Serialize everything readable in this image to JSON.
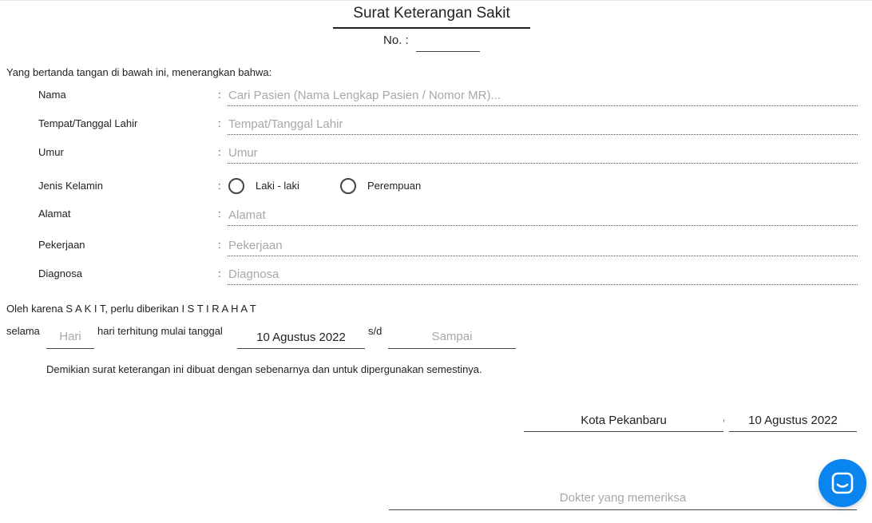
{
  "document": {
    "title": "Surat Keterangan Sakit",
    "number_label": "No. :",
    "number_value": "",
    "intro": "Yang bertanda tangan di bawah ini, menerangkan bahwa:"
  },
  "fields": {
    "nama": {
      "label": "Nama",
      "placeholder": "Cari Pasien (Nama Lengkap Pasien / Nomor MR)...",
      "value": ""
    },
    "ttl": {
      "label": "Tempat/Tanggal Lahir",
      "placeholder": "Tempat/Tanggal Lahir",
      "value": ""
    },
    "umur": {
      "label": "Umur",
      "placeholder": "Umur",
      "value": ""
    },
    "jenis_kelamin": {
      "label": "Jenis Kelamin",
      "options": [
        "Laki - laki",
        "Perempuan"
      ],
      "selected": null
    },
    "alamat": {
      "label": "Alamat",
      "placeholder": "Alamat",
      "value": ""
    },
    "pekerjaan": {
      "label": "Pekerjaan",
      "placeholder": "Pekerjaan",
      "value": ""
    },
    "diagnosa": {
      "label": "Diagnosa",
      "placeholder": "Diagnosa",
      "value": ""
    },
    "colon": ":"
  },
  "rest": {
    "sentence": "Oleh karena S A K I T, perlu diberikan I S T I R A H A T",
    "selama_label": "selama",
    "hari_placeholder": "Hari",
    "hari_value": "",
    "hari_text": "hari terhitung mulai tanggal",
    "start_date": "10 Agustus 2022",
    "sd_label": "s/d",
    "end_placeholder": "Sampai",
    "end_value": ""
  },
  "closing": "Demikian surat keterangan ini dibuat dengan sebenarnya dan untuk dipergunakan semestinya.",
  "signature": {
    "city": "Kota Pekanbaru",
    "separator": ",",
    "date": "10 Agustus 2022",
    "doctor_placeholder": "Dokter yang memeriksa",
    "doctor_value": ""
  },
  "chat_widget": {
    "icon": "chat-icon",
    "color": "#0a84ef"
  }
}
